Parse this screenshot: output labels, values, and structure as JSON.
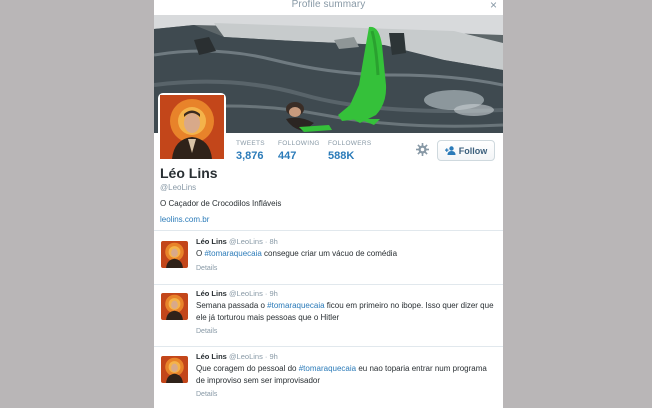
{
  "modal": {
    "title": "Profile summary",
    "close": "×"
  },
  "profile": {
    "name": "Léo Lins",
    "handle": "@LeoLins",
    "bio": "O Caçador de Crocodilos Infláveis",
    "website": "leolins.com.br",
    "follow_label": "Follow"
  },
  "stats": [
    {
      "label": "TWEETS",
      "value": "3,876"
    },
    {
      "label": "FOLLOWING",
      "value": "447"
    },
    {
      "label": "FOLLOWERS",
      "value": "588K"
    }
  ],
  "tweets": [
    {
      "name": "Léo Lins",
      "handle": "@LeoLins",
      "dot": "·",
      "time": "8h",
      "text_pre": "O ",
      "hashtag": "#tomaraquecaia",
      "text_post": " consegue criar um vácuo de comédia",
      "details": "Details"
    },
    {
      "name": "Léo Lins",
      "handle": "@LeoLins",
      "dot": "·",
      "time": "9h",
      "text_pre": "Semana passada o ",
      "hashtag": "#tomaraquecaia",
      "text_post": " ficou em primeiro no ibope. Isso quer dizer que ele já torturou mais pessoas que o Hitler",
      "details": "Details"
    },
    {
      "name": "Léo Lins",
      "handle": "@LeoLins",
      "dot": "·",
      "time": "9h",
      "text_pre": "Que coragem do pessoal do ",
      "hashtag": "#tomaraquecaia",
      "text_post": " eu nao toparia entrar num programa de improviso sem ser improvisador",
      "details": "Details"
    }
  ],
  "colors": {
    "link": "#2b7bb9",
    "muted": "#8899a6",
    "text": "#292f33",
    "overlay": "#b9b6b7"
  },
  "icons": {
    "gear": "gear-icon",
    "follow": "add-user-icon",
    "close": "close-icon"
  }
}
